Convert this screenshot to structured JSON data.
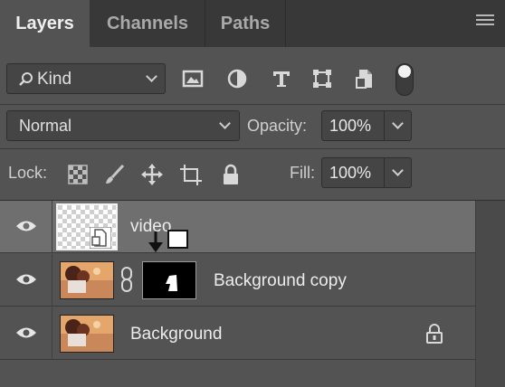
{
  "tabs": {
    "layers": "Layers",
    "channels": "Channels",
    "paths": "Paths"
  },
  "filter": {
    "kind_label": "Kind",
    "icons": [
      "image-filter-icon",
      "adjustment-filter-icon",
      "type-filter-icon",
      "shape-filter-icon",
      "smart-object-filter-icon"
    ]
  },
  "blend": {
    "mode": "Normal",
    "opacity_label": "Opacity:",
    "opacity_value": "100%"
  },
  "lock": {
    "label": "Lock:",
    "fill_label": "Fill:",
    "fill_value": "100%"
  },
  "layers": [
    {
      "name": "video",
      "type": "smart-object",
      "selected": true,
      "visible": true
    },
    {
      "name": "Background copy",
      "type": "masked-image",
      "selected": false,
      "visible": true,
      "linked_mask": true
    },
    {
      "name": "Background",
      "type": "image",
      "selected": false,
      "visible": true,
      "locked": true
    }
  ],
  "colors": {
    "panel": "#535353",
    "tabbar": "#383838",
    "selected_row": "#6f6f6f"
  }
}
